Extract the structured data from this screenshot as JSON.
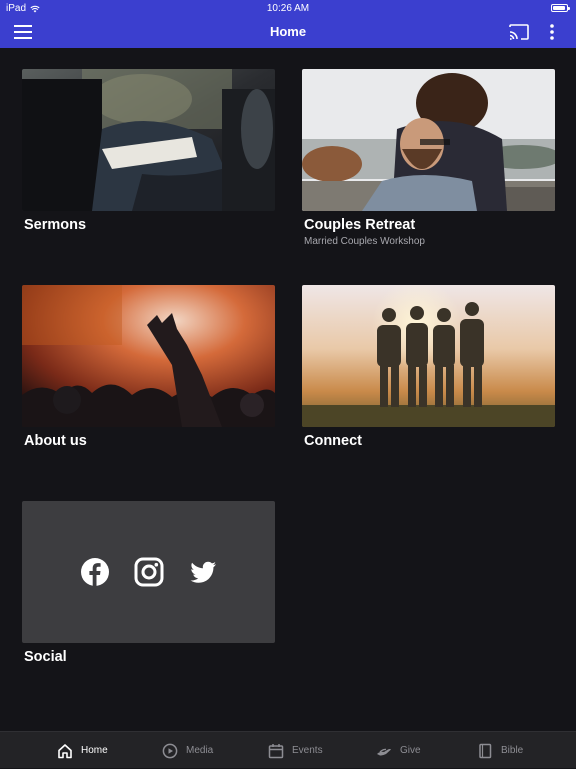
{
  "status_bar": {
    "device": "iPad",
    "time": "10:26 AM",
    "battery_level": 0.9
  },
  "app_bar": {
    "title": "Home",
    "icons": [
      "menu-icon",
      "cast-icon",
      "more-vert-icon"
    ]
  },
  "cards": [
    {
      "title": "Sermons",
      "subtitle": ""
    },
    {
      "title": "Couples Retreat",
      "subtitle": "Married Couples Workshop"
    },
    {
      "title": "About us",
      "subtitle": ""
    },
    {
      "title": "Connect",
      "subtitle": ""
    },
    {
      "title": "Social",
      "subtitle": ""
    }
  ],
  "social_icons": [
    "facebook-icon",
    "instagram-icon",
    "twitter-icon"
  ],
  "bottom_nav": {
    "items": [
      {
        "label": "Home",
        "icon": "home-icon",
        "active": true
      },
      {
        "label": "Media",
        "icon": "play-circle-icon",
        "active": false
      },
      {
        "label": "Events",
        "icon": "calendar-icon",
        "active": false
      },
      {
        "label": "Give",
        "icon": "give-icon",
        "active": false
      },
      {
        "label": "Bible",
        "icon": "book-icon",
        "active": false
      }
    ]
  },
  "colors": {
    "app_bar": "#3b3fcf",
    "background": "#141418",
    "tab_bar": "#232326",
    "social_tile": "#3d3d40",
    "inactive_tab": "#8d8d93"
  }
}
